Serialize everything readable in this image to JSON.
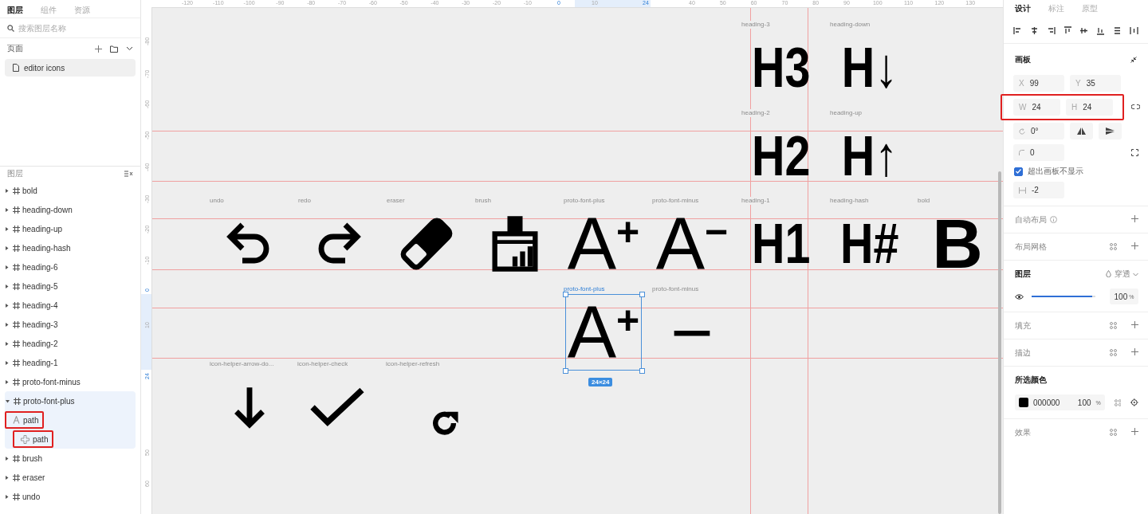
{
  "left_panel": {
    "tabs": [
      {
        "label": "图层",
        "selected": true
      },
      {
        "label": "组件",
        "selected": false
      },
      {
        "label": "资源",
        "selected": false
      }
    ],
    "search": {
      "placeholder": "搜索图层名称"
    },
    "pages_title": "页面",
    "pages": [
      {
        "name": "editor icons",
        "selected": true
      }
    ],
    "layers_title": "图层",
    "layers": [
      {
        "name": "bold",
        "expanded": false,
        "selected": false
      },
      {
        "name": "heading-down",
        "expanded": false,
        "selected": false
      },
      {
        "name": "heading-up",
        "expanded": false,
        "selected": false
      },
      {
        "name": "heading-hash",
        "expanded": false,
        "selected": false
      },
      {
        "name": "heading-6",
        "expanded": false,
        "selected": false
      },
      {
        "name": "heading-5",
        "expanded": false,
        "selected": false
      },
      {
        "name": "heading-4",
        "expanded": false,
        "selected": false
      },
      {
        "name": "heading-3",
        "expanded": false,
        "selected": false
      },
      {
        "name": "heading-2",
        "expanded": false,
        "selected": false
      },
      {
        "name": "heading-1",
        "expanded": false,
        "selected": false
      },
      {
        "name": "proto-font-minus",
        "expanded": false,
        "selected": false
      },
      {
        "name": "proto-font-plus",
        "expanded": true,
        "selected": true,
        "children": [
          {
            "name": "path",
            "kind": "letter",
            "annotated": true
          },
          {
            "name": "path",
            "kind": "cross",
            "annotated": true
          }
        ]
      },
      {
        "name": "brush",
        "expanded": false,
        "selected": false
      },
      {
        "name": "eraser",
        "expanded": false,
        "selected": false
      },
      {
        "name": "undo",
        "expanded": false,
        "selected": false
      }
    ]
  },
  "ruler": {
    "top": [
      {
        "label": "-120",
        "highlighted": false
      },
      {
        "label": "-110",
        "highlighted": false
      },
      {
        "label": "-100",
        "highlighted": false
      },
      {
        "label": "-90",
        "highlighted": false
      },
      {
        "label": "-80",
        "highlighted": false
      },
      {
        "label": "-70",
        "highlighted": false
      },
      {
        "label": "-60",
        "highlighted": false
      },
      {
        "label": "-50",
        "highlighted": false
      },
      {
        "label": "-40",
        "highlighted": false
      },
      {
        "label": "-30",
        "highlighted": false
      },
      {
        "label": "-20",
        "highlighted": false
      },
      {
        "label": "-10",
        "highlighted": false
      },
      {
        "label": "0",
        "highlighted": true
      },
      {
        "label": "10",
        "highlighted": false
      },
      {
        "label": "24",
        "highlighted": true
      },
      {
        "label": "40",
        "highlighted": false
      },
      {
        "label": "50",
        "highlighted": false
      },
      {
        "label": "60",
        "highlighted": false
      },
      {
        "label": "70",
        "highlighted": false
      },
      {
        "label": "80",
        "highlighted": false
      },
      {
        "label": "90",
        "highlighted": false
      },
      {
        "label": "100",
        "highlighted": false
      },
      {
        "label": "110",
        "highlighted": false
      },
      {
        "label": "120",
        "highlighted": false
      },
      {
        "label": "130",
        "highlighted": false
      }
    ],
    "left": [
      {
        "label": "-80",
        "highlighted": false
      },
      {
        "label": "-70",
        "highlighted": false
      },
      {
        "label": "-60",
        "highlighted": false
      },
      {
        "label": "-50",
        "highlighted": false
      },
      {
        "label": "-40",
        "highlighted": false
      },
      {
        "label": "-30",
        "highlighted": false
      },
      {
        "label": "-20",
        "highlighted": false
      },
      {
        "label": "-10",
        "highlighted": false
      },
      {
        "label": "0",
        "highlighted": true
      },
      {
        "label": "10",
        "highlighted": false
      },
      {
        "label": "24",
        "highlighted": true
      },
      {
        "label": "50",
        "highlighted": false
      },
      {
        "label": "60",
        "highlighted": false
      }
    ]
  },
  "canvas": {
    "artboards": [
      {
        "label": "heading-3",
        "glyph": "H3",
        "selected": false
      },
      {
        "label": "heading-down",
        "glyph": "H↓",
        "selected": false
      },
      {
        "label": "heading-2",
        "glyph": "H2",
        "selected": false
      },
      {
        "label": "heading-up",
        "glyph": "H↑",
        "selected": false
      },
      {
        "label": "undo",
        "selected": false
      },
      {
        "label": "redo",
        "selected": false
      },
      {
        "label": "eraser",
        "selected": false
      },
      {
        "label": "brush",
        "selected": false
      },
      {
        "label": "proto-font-plus",
        "glyph": "A$^{+}$",
        "selected": false
      },
      {
        "label": "proto-font-minus",
        "glyph": "A$^{−}$",
        "selected": false
      },
      {
        "label": "heading-1",
        "glyph": "H1",
        "selected": false
      },
      {
        "label": "heading-hash",
        "glyph": "H#",
        "selected": false
      },
      {
        "label": "bold",
        "glyph": "B",
        "selected": false
      },
      {
        "label": "proto-font-plus",
        "glyph": "A$^{+}$",
        "selected": true
      },
      {
        "label": "proto-font-minus",
        "glyph": "−",
        "selected": false
      },
      {
        "label": "icon-helper-arrow-do...",
        "selected": false
      },
      {
        "label": "icon-helper-check",
        "selected": false
      },
      {
        "label": "icon-helper-refresh",
        "selected": false
      }
    ],
    "selection_size": "24×24"
  },
  "right_panel": {
    "tabs": [
      {
        "label": "设计",
        "selected": true
      },
      {
        "label": "标注",
        "selected": false
      },
      {
        "label": "原型",
        "selected": false
      }
    ],
    "frame_title": "画板",
    "position": [
      {
        "label": "X",
        "value": "99"
      },
      {
        "label": "Y",
        "value": "35"
      }
    ],
    "size": [
      {
        "label": "W",
        "value": "24"
      },
      {
        "label": "H",
        "value": "24"
      }
    ],
    "size_annotated": true,
    "rotation": "0°",
    "corner": "0",
    "clip_content": {
      "label": "超出画板不显示",
      "checked": true
    },
    "spacing": "-2",
    "sections": [
      {
        "kind": "add",
        "title": "自动布局",
        "info": true,
        "styles": false
      },
      {
        "kind": "add",
        "title": "布局网格",
        "info": false,
        "styles": true
      },
      {
        "kind": "layer",
        "title": "图层",
        "blend": "穿透",
        "level": 0.95,
        "opacity": "100",
        "unit": "%"
      },
      {
        "kind": "add",
        "title": "填充",
        "info": false,
        "styles": true
      },
      {
        "kind": "add",
        "title": "描边",
        "info": false,
        "styles": true
      },
      {
        "kind": "color",
        "title": "所选颜色",
        "color": "#000000",
        "hex": "000000",
        "opacity": "100",
        "unit": "%"
      },
      {
        "kind": "add",
        "title": "效果",
        "info": false,
        "styles": true
      }
    ]
  }
}
